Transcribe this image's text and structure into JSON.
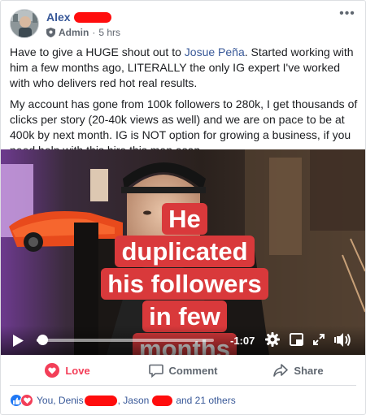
{
  "post": {
    "author": "Alex",
    "role": "Admin",
    "separator": "·",
    "timestamp": "5 hrs",
    "more_label": "•••",
    "paragraph1_before": "Have to give a HUGE shout out to ",
    "mention": "Josue Peña",
    "paragraph1_after": ". Started working with him a few months ago, LITERALLY the only IG expert I've worked with who delivers red hot real results.",
    "paragraph2": "My account has gone from 100k followers to 280k, I get thousands of clicks per story (20-40k views as well) and we are on pace to be at 400k by next month. IG is NOT option for growing a business, if you need help with this hire this man asap."
  },
  "video": {
    "caption": "He duplicated his followers in few months",
    "time_remaining": "-1:07",
    "progress_fraction": 0.03,
    "icons": [
      "play-icon",
      "gear-icon",
      "pip-icon",
      "fullscreen-icon",
      "volume-icon"
    ]
  },
  "actions": {
    "love_label": "Love",
    "comment_label": "Comment",
    "share_label": "Share"
  },
  "reactions": {
    "prefix": "You, Denis",
    "middle": ", Jason",
    "suffix": "and 21 others"
  },
  "colors": {
    "link": "#385898",
    "love": "#f33e58",
    "like": "#2078f4",
    "caption_bg": "#d9393b",
    "redaction": "#ff0d0d"
  }
}
